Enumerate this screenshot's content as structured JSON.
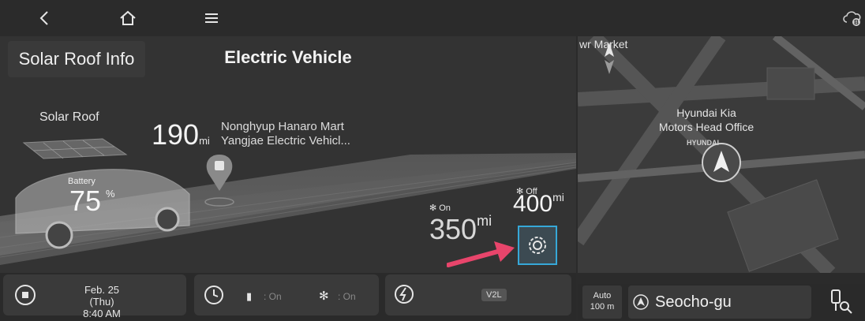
{
  "topbar": {
    "back_icon": "back-chevron-icon",
    "home_icon": "home-icon",
    "menu_icon": "menu-icon",
    "cloud_badge": "B"
  },
  "header": {
    "solar_tab_label": "Solar Roof Info",
    "title": "Electric Vehicle"
  },
  "vehicle": {
    "solar_roof_label": "Solar Roof",
    "battery_label": "Battery",
    "battery_value": "75",
    "battery_unit": "%"
  },
  "destination": {
    "distance_value": "190",
    "distance_unit": "mi",
    "poi_line1": "Nonghyup Hanaro Mart",
    "poi_line2": "Yangjae Electric Vehicl..."
  },
  "range": {
    "on_label": "On",
    "on_value": "350",
    "on_unit": "mi",
    "off_label": "Off",
    "off_value": "400",
    "off_unit": "mi",
    "settings_icon": "gear-icon"
  },
  "bottombar": {
    "plug_icon": "plug-icon",
    "date": "Feb. 25 (Thu)",
    "time": "8:40  AM",
    "clock_icon": "clock-icon",
    "charge_status": ": On",
    "fan_status": ": On",
    "v2l_label": "V2L"
  },
  "map": {
    "label_market": "wr Market",
    "label_hq_line1": "Hyundai Kia",
    "label_hq_line2": "Motors Head Office",
    "label_brand": "HYUNDAI",
    "auto_label": "Auto",
    "scale_label": "100 m",
    "location_name": "Seocho-gu"
  },
  "colors": {
    "accent": "#36a8d8",
    "arrow": "#e8456b"
  }
}
